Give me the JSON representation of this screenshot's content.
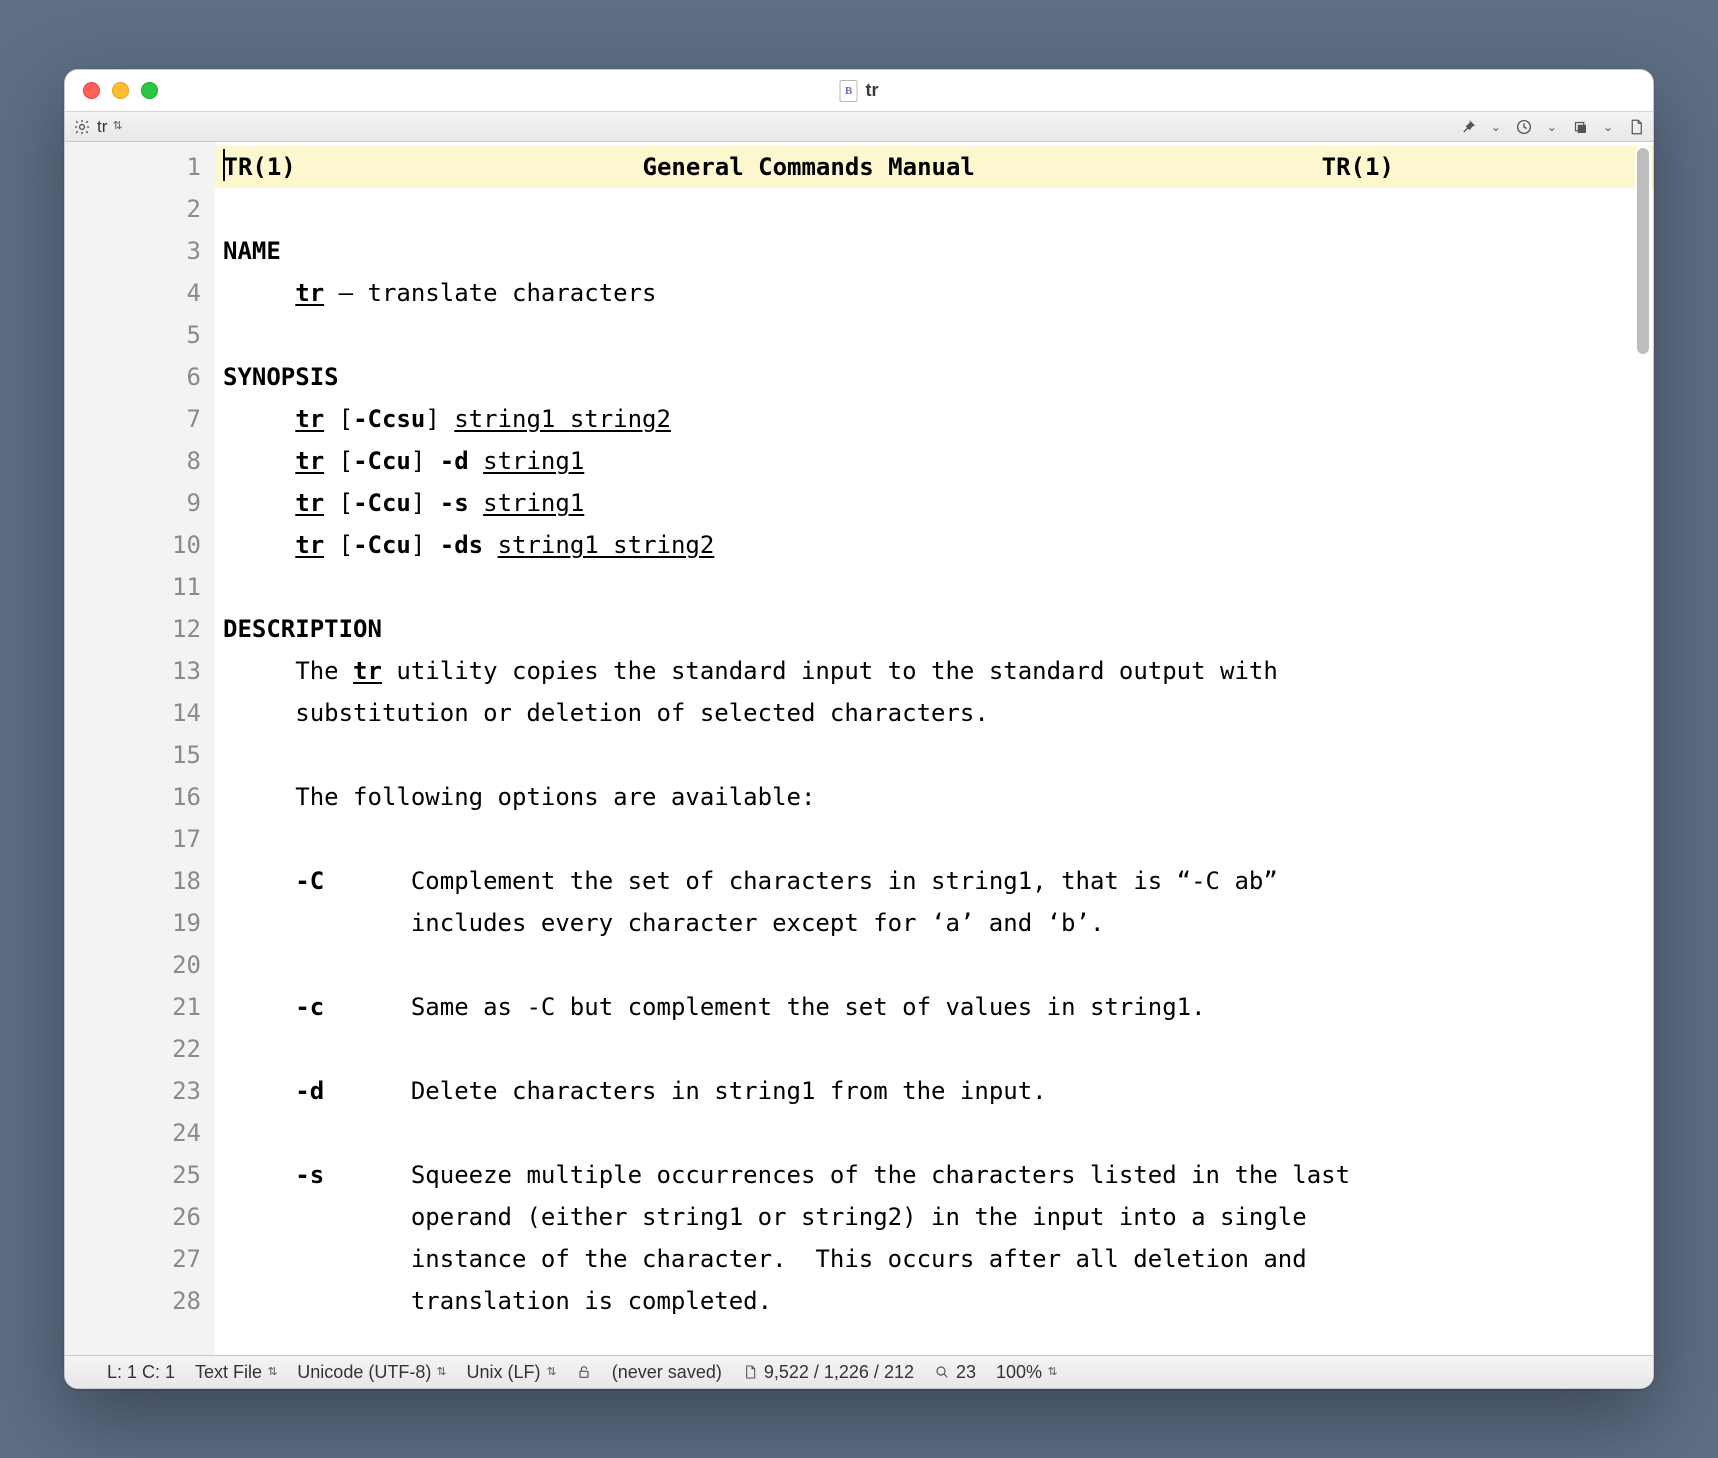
{
  "window": {
    "title": "tr"
  },
  "toolbar": {
    "filename": "tr"
  },
  "editor": {
    "line_numbers_start": 1,
    "line_numbers_end": 28,
    "lines": [
      {
        "segments": [
          {
            "t": "TR(1)",
            "cls": "b"
          },
          {
            "t": "                        "
          },
          {
            "t": "General Commands Manual",
            "cls": "b"
          },
          {
            "t": "                        "
          },
          {
            "t": "TR(1)",
            "cls": "b"
          }
        ],
        "hl": true,
        "caret_before": true
      },
      {
        "segments": []
      },
      {
        "segments": [
          {
            "t": "NAME",
            "cls": "b"
          }
        ]
      },
      {
        "segments": [
          {
            "t": "     "
          },
          {
            "t": "tr",
            "cls": "b u"
          },
          {
            "t": " – translate characters"
          }
        ]
      },
      {
        "segments": []
      },
      {
        "segments": [
          {
            "t": "SYNOPSIS",
            "cls": "b"
          }
        ]
      },
      {
        "segments": [
          {
            "t": "     "
          },
          {
            "t": "tr",
            "cls": "b u"
          },
          {
            "t": " ["
          },
          {
            "t": "-Ccsu",
            "cls": "b"
          },
          {
            "t": "] "
          },
          {
            "t": "string1 string2",
            "cls": "u"
          }
        ]
      },
      {
        "segments": [
          {
            "t": "     "
          },
          {
            "t": "tr",
            "cls": "b u"
          },
          {
            "t": " ["
          },
          {
            "t": "-Ccu",
            "cls": "b"
          },
          {
            "t": "] "
          },
          {
            "t": "-d",
            "cls": "b"
          },
          {
            "t": " "
          },
          {
            "t": "string1",
            "cls": "u"
          }
        ]
      },
      {
        "segments": [
          {
            "t": "     "
          },
          {
            "t": "tr",
            "cls": "b u"
          },
          {
            "t": " ["
          },
          {
            "t": "-Ccu",
            "cls": "b"
          },
          {
            "t": "] "
          },
          {
            "t": "-s",
            "cls": "b"
          },
          {
            "t": " "
          },
          {
            "t": "string1",
            "cls": "u"
          }
        ]
      },
      {
        "segments": [
          {
            "t": "     "
          },
          {
            "t": "tr",
            "cls": "b u"
          },
          {
            "t": " ["
          },
          {
            "t": "-Ccu",
            "cls": "b"
          },
          {
            "t": "] "
          },
          {
            "t": "-ds",
            "cls": "b"
          },
          {
            "t": " "
          },
          {
            "t": "string1 string2",
            "cls": "u"
          }
        ]
      },
      {
        "segments": []
      },
      {
        "segments": [
          {
            "t": "DESCRIPTION",
            "cls": "b"
          }
        ]
      },
      {
        "segments": [
          {
            "t": "     The "
          },
          {
            "t": "tr",
            "cls": "b u"
          },
          {
            "t": " utility copies the standard input to the standard output with"
          }
        ]
      },
      {
        "segments": [
          {
            "t": "     substitution or deletion of selected characters."
          }
        ]
      },
      {
        "segments": []
      },
      {
        "segments": [
          {
            "t": "     The following options are available:"
          }
        ]
      },
      {
        "segments": []
      },
      {
        "segments": [
          {
            "t": "     "
          },
          {
            "t": "-C",
            "cls": "b"
          },
          {
            "t": "      Complement the set of characters in string1, that is “-C ab”"
          }
        ]
      },
      {
        "segments": [
          {
            "t": "             includes every character except for ‘a’ and ‘b’."
          }
        ]
      },
      {
        "segments": []
      },
      {
        "segments": [
          {
            "t": "     "
          },
          {
            "t": "-c",
            "cls": "b"
          },
          {
            "t": "      Same as -C but complement the set of values in string1."
          }
        ]
      },
      {
        "segments": []
      },
      {
        "segments": [
          {
            "t": "     "
          },
          {
            "t": "-d",
            "cls": "b"
          },
          {
            "t": "      Delete characters in string1 from the input."
          }
        ]
      },
      {
        "segments": []
      },
      {
        "segments": [
          {
            "t": "     "
          },
          {
            "t": "-s",
            "cls": "b"
          },
          {
            "t": "      Squeeze multiple occurrences of the characters listed in the last"
          }
        ]
      },
      {
        "segments": [
          {
            "t": "             operand (either string1 or string2) in the input into a single"
          }
        ]
      },
      {
        "segments": [
          {
            "t": "             instance of the character.  This occurs after all deletion and"
          }
        ]
      },
      {
        "segments": [
          {
            "t": "             translation is completed."
          }
        ]
      }
    ]
  },
  "status": {
    "cursor": "L: 1 C: 1",
    "syntax": "Text File",
    "encoding": "Unicode (UTF-8)",
    "line_endings": "Unix (LF)",
    "save_state": "(never saved)",
    "counts": "9,522 / 1,226 / 212",
    "search_count": "23",
    "zoom": "100%"
  }
}
